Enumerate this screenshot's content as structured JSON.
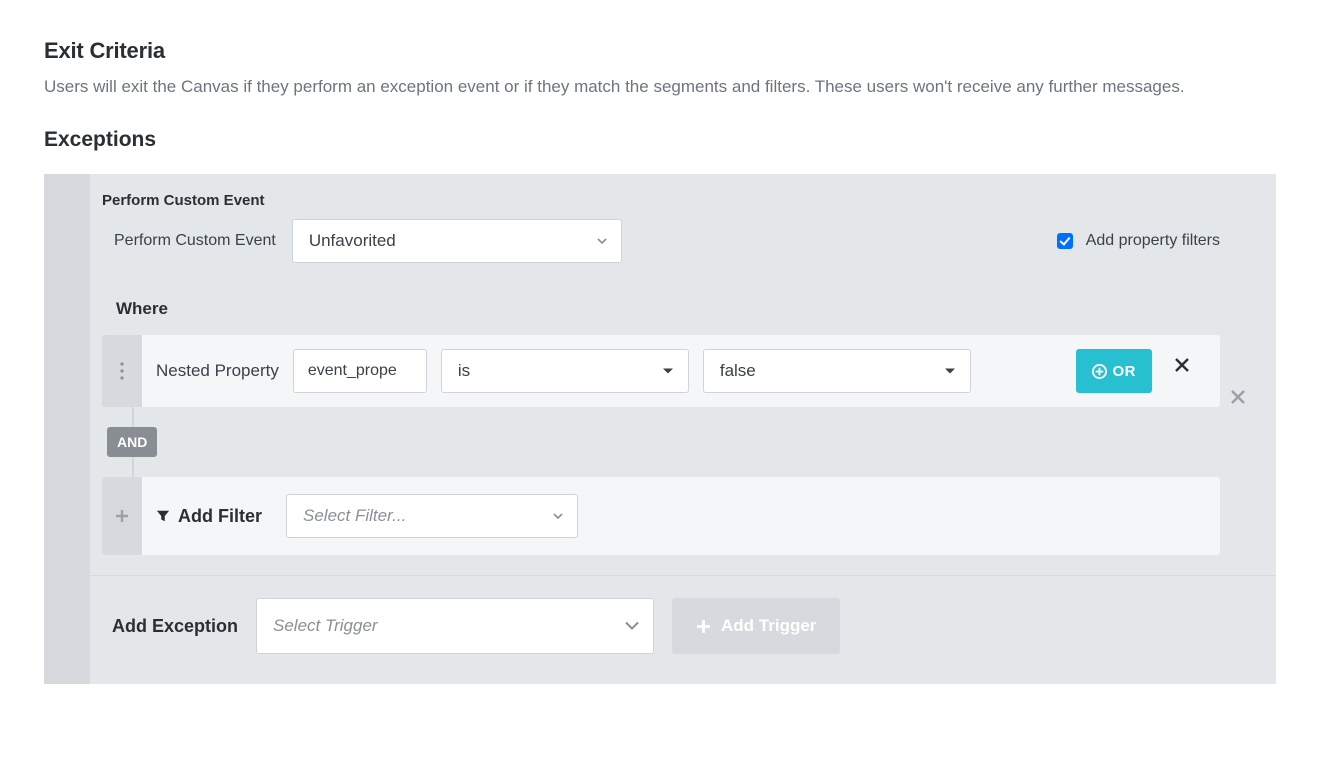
{
  "exitCriteria": {
    "heading": "Exit Criteria",
    "description": "Users will exit the Canvas if they perform an exception event or if they match the segments and filters. These users won't receive any further messages."
  },
  "exceptions": {
    "heading": "Exceptions",
    "eventTitle": "Perform Custom Event",
    "eventLabel": "Perform Custom Event",
    "eventSelected": "Unfavorited",
    "addPropertyFilters": {
      "checked": true,
      "label": "Add property filters"
    },
    "whereHeading": "Where",
    "filterRow": {
      "propertyLabel": "Nested Property",
      "propertyValue": "event_prope",
      "operator": "is",
      "value": "false",
      "orLabel": "OR"
    },
    "andLabel": "AND",
    "addFilter": {
      "label": "Add Filter",
      "placeholder": "Select Filter..."
    }
  },
  "addException": {
    "label": "Add Exception",
    "triggerPlaceholder": "Select Trigger",
    "addTriggerLabel": "Add Trigger"
  }
}
